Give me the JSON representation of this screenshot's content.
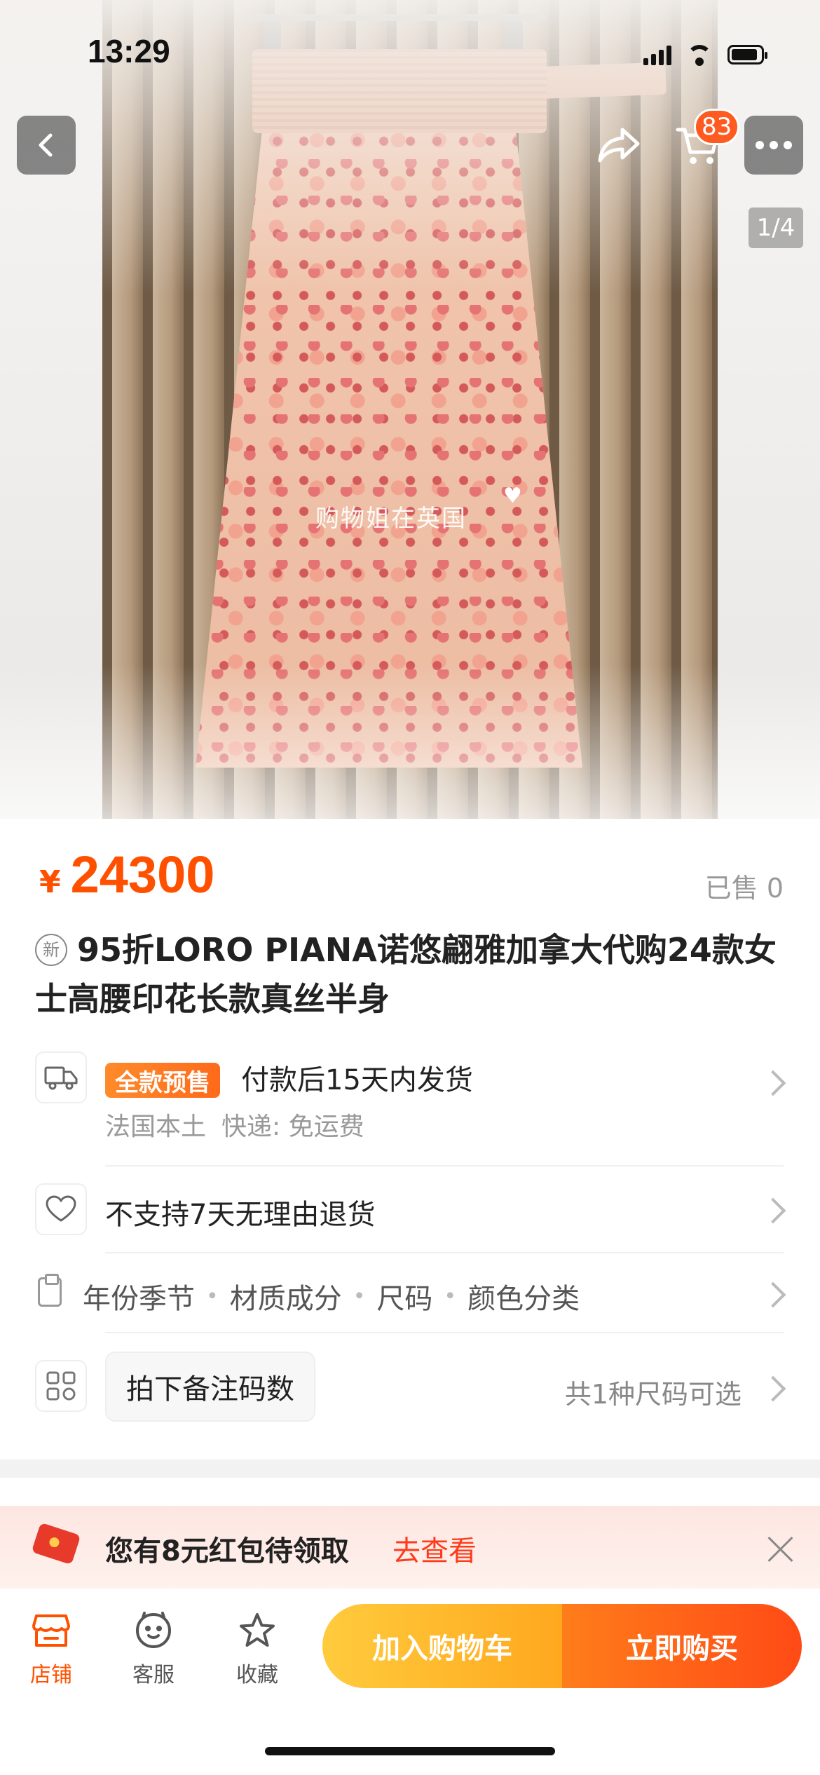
{
  "status_bar": {
    "time": "13:29"
  },
  "header": {
    "cart_count": "83",
    "pager": "1/4"
  },
  "image": {
    "watermark": "购物姐在英国"
  },
  "product": {
    "currency": "¥",
    "price": "24300",
    "sold": "已售 0",
    "new_badge": "新",
    "title": "95折LORO PIANA诺悠翩雅加拿大代购24款女士高腰印花长款真丝半身"
  },
  "shipping": {
    "badge": "全款预售",
    "text": "付款后15天内发货",
    "origin": "法国本土",
    "courier": "快递: 免运费"
  },
  "returns": {
    "text": "不支持7天无理由退货"
  },
  "attributes": [
    "年份季节",
    "材质成分",
    "尺码",
    "颜色分类"
  ],
  "sku": {
    "note": "拍下备注码数",
    "count": "共1种尺码可选"
  },
  "coupon": {
    "text": "您有8元红包待领取",
    "link": "去查看"
  },
  "bottom_bar": {
    "tabs": [
      {
        "label": "店铺",
        "icon": "store-icon"
      },
      {
        "label": "客服",
        "icon": "service-icon"
      },
      {
        "label": "收藏",
        "icon": "star-icon"
      }
    ],
    "add_to_cart": "加入购物车",
    "buy_now": "立即购买"
  },
  "colors": {
    "accent": "#ff5000",
    "cart_button": "#ffb21e",
    "buy_button": "#ff5a16"
  }
}
